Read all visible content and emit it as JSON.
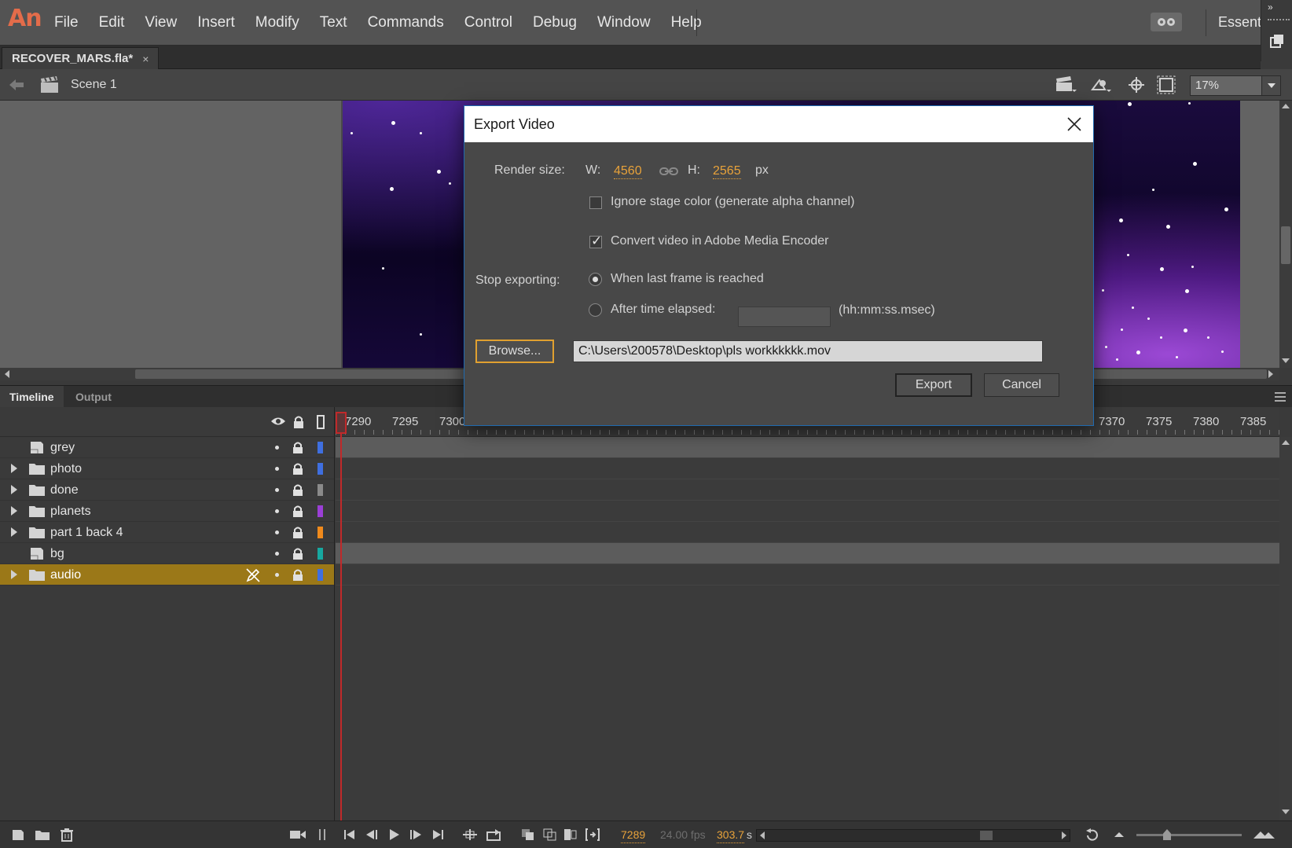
{
  "app": {
    "logo": "An"
  },
  "menu": [
    "File",
    "Edit",
    "View",
    "Insert",
    "Modify",
    "Text",
    "Commands",
    "Control",
    "Debug",
    "Window",
    "Help"
  ],
  "workspace": {
    "label": "Essent"
  },
  "document": {
    "tab_title": "RECOVER_MARS.fla*",
    "close_glyph": "×"
  },
  "editbar": {
    "scene_label": "Scene 1",
    "zoom": "17%"
  },
  "timeline": {
    "tabs": [
      "Timeline",
      "Output"
    ],
    "ruler_labels": [
      "7290",
      "7295",
      "7300",
      "7370",
      "7375",
      "7380",
      "7385"
    ],
    "layers": [
      {
        "name": "grey",
        "type": "layer",
        "color": "#3f6fe0",
        "expandable": false,
        "selected": false
      },
      {
        "name": "photo",
        "type": "folder",
        "color": "#3f6fe0",
        "expandable": true,
        "selected": false
      },
      {
        "name": "done",
        "type": "folder",
        "color": "#8a8a8a",
        "expandable": true,
        "selected": false
      },
      {
        "name": "planets",
        "type": "folder",
        "color": "#9b3fd6",
        "expandable": true,
        "selected": false
      },
      {
        "name": "part 1 back 4",
        "type": "folder",
        "color": "#f08a1c",
        "expandable": true,
        "selected": false
      },
      {
        "name": "bg",
        "type": "layer",
        "color": "#17a8a0",
        "expandable": false,
        "selected": false
      },
      {
        "name": "audio",
        "type": "folder",
        "color": "#3f6fe0",
        "expandable": true,
        "selected": true
      }
    ],
    "current_frame": "7289",
    "fps": "24.00 fps",
    "elapsed": "303.7",
    "elapsed_unit": "s"
  },
  "dialog": {
    "title": "Export Video",
    "render_size_label": "Render size:",
    "width_label": "W:",
    "width_value": "4560",
    "height_label": "H:",
    "height_value": "2565",
    "unit": "px",
    "ignore_stage_color": {
      "label": "Ignore stage color (generate alpha channel)",
      "checked": false
    },
    "convert_video": {
      "label": "Convert video in Adobe Media Encoder",
      "checked": true
    },
    "stop_exporting_label": "Stop exporting:",
    "option_last_frame": {
      "label": "When last frame is reached",
      "selected": true
    },
    "option_time_elapsed": {
      "label": "After time elapsed:",
      "selected": false,
      "value": "",
      "format_hint": "(hh:mm:ss.msec)"
    },
    "browse_label": "Browse...",
    "path_value": "C:\\Users\\200578\\Desktop\\pls workkkkkk.mov",
    "export_label": "Export",
    "cancel_label": "Cancel"
  },
  "colors": {
    "accent_orange": "#e8a23a",
    "selection": "#9b7818",
    "playhead": "#c0292a",
    "dialog_border": "#1f6ab0"
  }
}
